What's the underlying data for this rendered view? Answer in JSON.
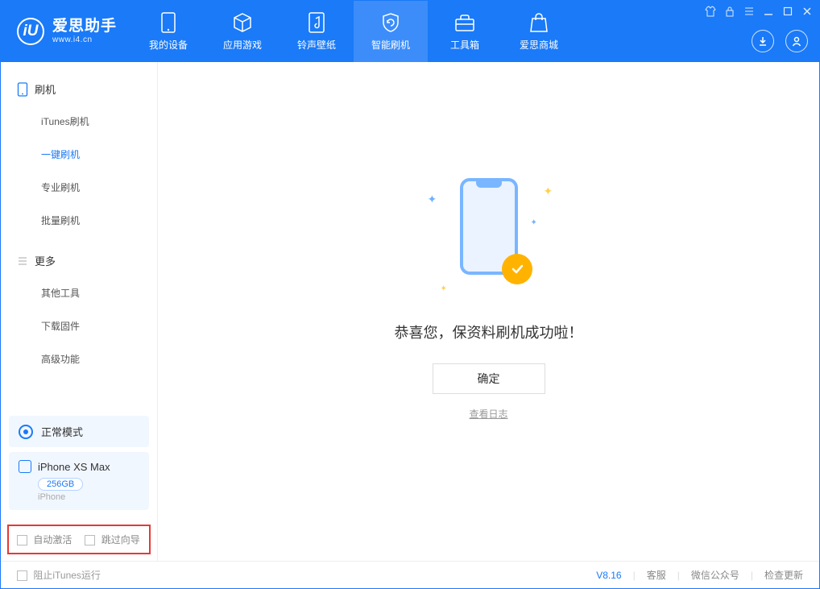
{
  "app": {
    "title": "爱思助手",
    "subtitle": "www.i4.cn"
  },
  "nav": {
    "tabs": [
      {
        "label": "我的设备"
      },
      {
        "label": "应用游戏"
      },
      {
        "label": "铃声壁纸"
      },
      {
        "label": "智能刷机"
      },
      {
        "label": "工具箱"
      },
      {
        "label": "爱思商城"
      }
    ]
  },
  "sidebar": {
    "section_flash": "刷机",
    "section_more": "更多",
    "flash_items": [
      {
        "label": "iTunes刷机"
      },
      {
        "label": "一键刷机"
      },
      {
        "label": "专业刷机"
      },
      {
        "label": "批量刷机"
      }
    ],
    "more_items": [
      {
        "label": "其他工具"
      },
      {
        "label": "下载固件"
      },
      {
        "label": "高级功能"
      }
    ],
    "status_label": "正常模式",
    "device_name": "iPhone XS Max",
    "device_capacity": "256GB",
    "device_type": "iPhone",
    "opt_auto_activate": "自动激活",
    "opt_skip_guide": "跳过向导"
  },
  "main": {
    "success_text": "恭喜您，保资料刷机成功啦！",
    "ok_button": "确定",
    "view_log": "查看日志"
  },
  "footer": {
    "block_itunes": "阻止iTunes运行",
    "version": "V8.16",
    "support": "客服",
    "wechat": "微信公众号",
    "check_update": "检查更新"
  }
}
